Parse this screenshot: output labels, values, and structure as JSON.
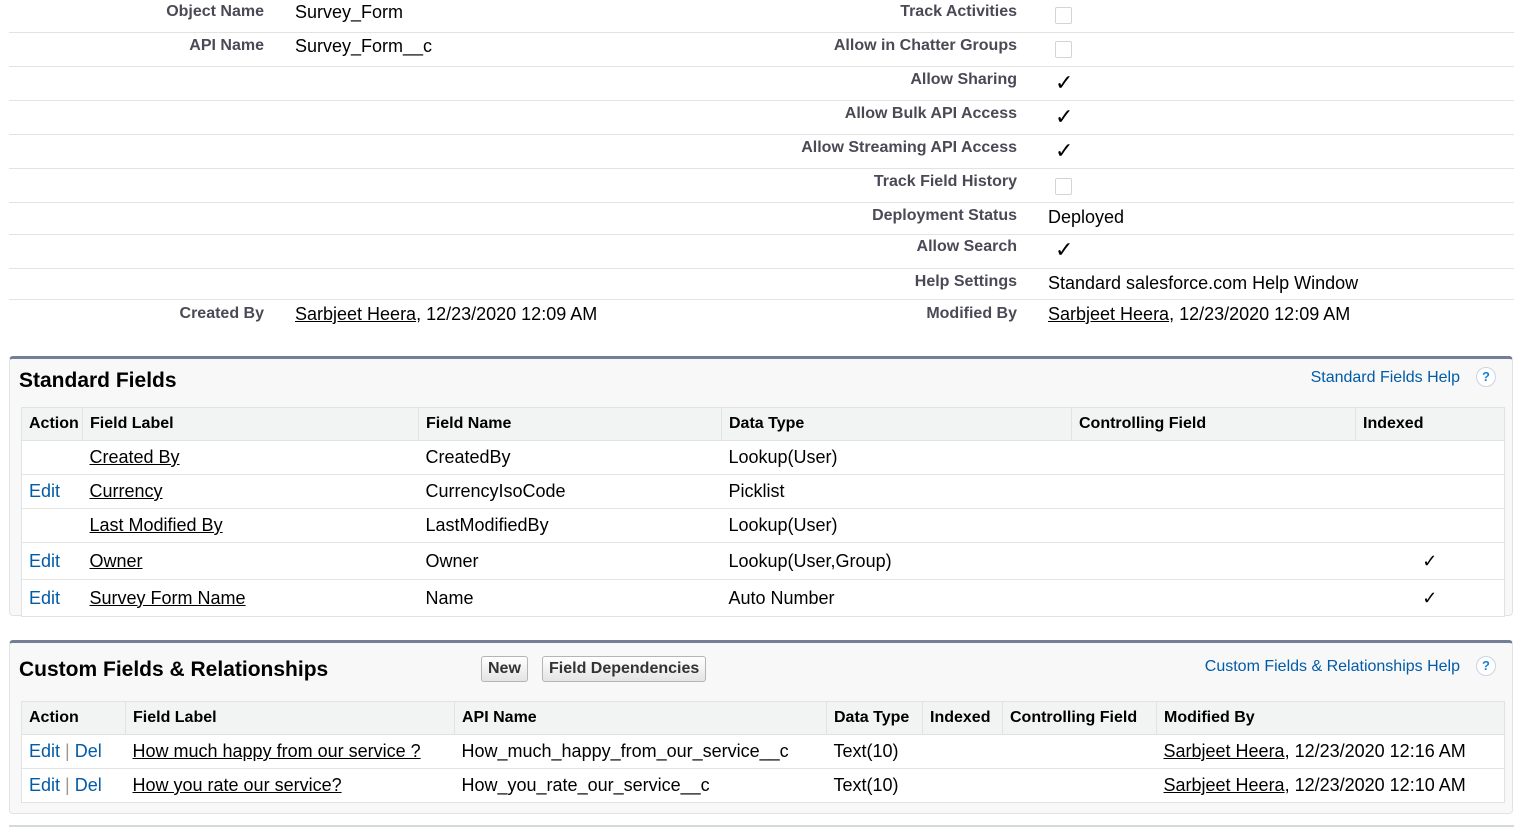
{
  "detail": {
    "object_name_label": "Object Name",
    "object_name": "Survey_Form",
    "api_name_label": "API Name",
    "api_name": "Survey_Form__c",
    "track_activities_label": "Track Activities",
    "allow_chatter_groups_label": "Allow in Chatter Groups",
    "allow_sharing_label": "Allow Sharing",
    "allow_bulk_api_label": "Allow Bulk API Access",
    "allow_streaming_api_label": "Allow Streaming API Access",
    "track_field_history_label": "Track Field History",
    "deployment_status_label": "Deployment Status",
    "deployment_status": "Deployed",
    "allow_search_label": "Allow Search",
    "help_settings_label": "Help Settings",
    "help_settings": "Standard salesforce.com Help Window",
    "created_by_label": "Created By",
    "created_by_user": "Sarbjeet Heera",
    "created_by_date": ", 12/23/2020 12:09 AM",
    "modified_by_label": "Modified By",
    "modified_by_user": "Sarbjeet Heera",
    "modified_by_date": ", 12/23/2020 12:09 AM",
    "checked_mark": "✓"
  },
  "standard_fields": {
    "title": "Standard Fields",
    "help_link": "Standard Fields Help",
    "help_icon": "?",
    "headers": [
      "Action",
      "Field Label",
      "Field Name",
      "Data Type",
      "Controlling Field",
      "Indexed"
    ],
    "rows": [
      {
        "action": "",
        "label": "Created By",
        "name": "CreatedBy",
        "type": "Lookup(User)",
        "controlling": "",
        "indexed": ""
      },
      {
        "action": "Edit",
        "label": "Currency",
        "name": "CurrencyIsoCode",
        "type": "Picklist",
        "controlling": "",
        "indexed": ""
      },
      {
        "action": "",
        "label": "Last Modified By",
        "name": "LastModifiedBy",
        "type": "Lookup(User)",
        "controlling": "",
        "indexed": ""
      },
      {
        "action": "Edit",
        "label": "Owner",
        "name": "Owner",
        "type": "Lookup(User,Group)",
        "controlling": "",
        "indexed": "✓"
      },
      {
        "action": "Edit",
        "label": "Survey Form Name",
        "name": "Name",
        "type": "Auto Number",
        "controlling": "",
        "indexed": "✓"
      }
    ]
  },
  "custom_fields": {
    "title": "Custom Fields & Relationships",
    "new_button": "New",
    "deps_button": "Field Dependencies",
    "help_link": "Custom Fields & Relationships Help",
    "help_icon": "?",
    "headers": [
      "Action",
      "Field Label",
      "API Name",
      "Data Type",
      "Indexed",
      "Controlling Field",
      "Modified By"
    ],
    "edit_label": "Edit",
    "sep": "|",
    "del_label": "Del",
    "rows": [
      {
        "label": "How much happy from our service ?",
        "api": "How_much_happy_from_our_service__c",
        "type": "Text(10)",
        "indexed": "",
        "controlling": "",
        "user": "Sarbjeet Heera",
        "date": ", 12/23/2020 12:16 AM"
      },
      {
        "label": "How you rate our service?",
        "api": "How_you_rate_our_service__c",
        "type": "Text(10)",
        "indexed": "",
        "controlling": "",
        "user": "Sarbjeet Heera",
        "date": ", 12/23/2020 12:10 AM"
      }
    ]
  }
}
